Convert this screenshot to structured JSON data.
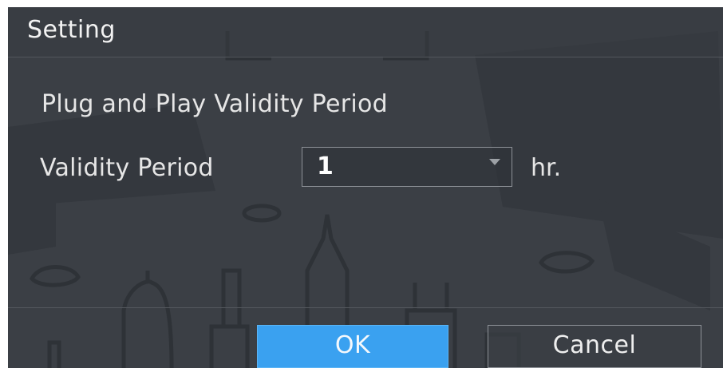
{
  "dialog": {
    "title": "Setting",
    "section_heading": "Plug and Play Validity Period",
    "validity_field": {
      "label": "Validity Period",
      "selected_value": "1",
      "unit": "hr."
    },
    "buttons": {
      "ok_label": "OK",
      "cancel_label": "Cancel"
    }
  },
  "colors": {
    "dialog_background": "#3b3f45",
    "primary_button": "#3aa1f0",
    "text": "#e6e6e6"
  }
}
